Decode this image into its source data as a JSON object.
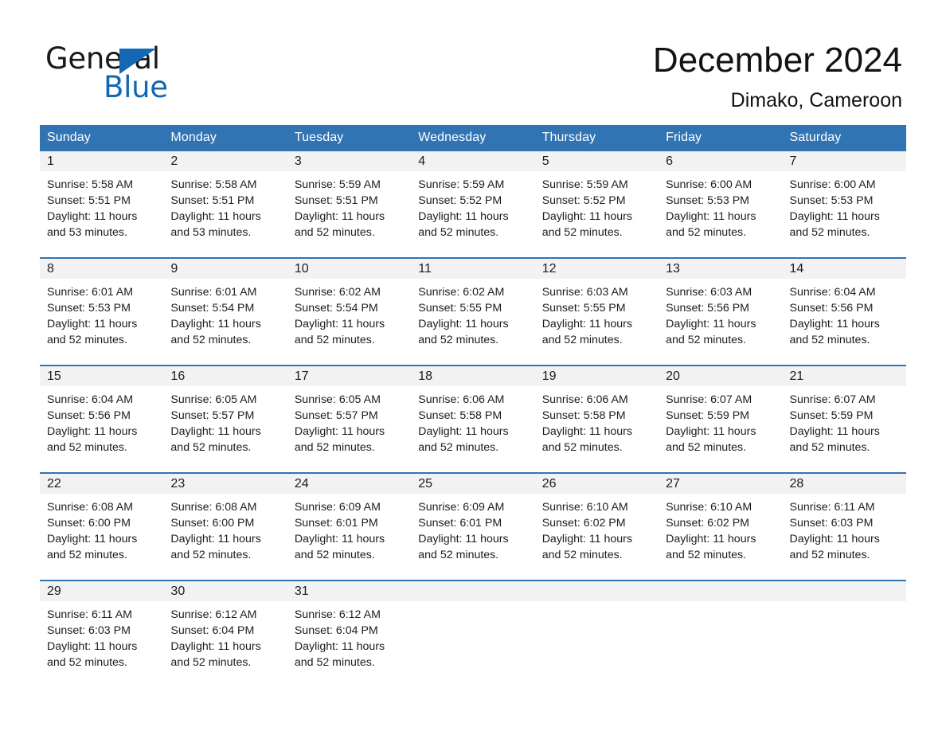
{
  "brand": {
    "name_part1": "General",
    "name_part2": "Blue",
    "accent_color": "#1268b3",
    "triangle_icon": "brand-triangle-icon"
  },
  "header": {
    "month_title": "December 2024",
    "location": "Dimako, Cameroon"
  },
  "theme": {
    "header_blue": "#3174b4",
    "row_divider_blue": "#3174b4",
    "daynum_band": "#f2f2f2",
    "text": "#1c1c1c"
  },
  "weekday_headers": [
    "Sunday",
    "Monday",
    "Tuesday",
    "Wednesday",
    "Thursday",
    "Friday",
    "Saturday"
  ],
  "weeks": [
    [
      {
        "day": "1",
        "sunrise": "Sunrise: 5:58 AM",
        "sunset": "Sunset: 5:51 PM",
        "daylight_line1": "Daylight: 11 hours",
        "daylight_line2": "and 53 minutes."
      },
      {
        "day": "2",
        "sunrise": "Sunrise: 5:58 AM",
        "sunset": "Sunset: 5:51 PM",
        "daylight_line1": "Daylight: 11 hours",
        "daylight_line2": "and 53 minutes."
      },
      {
        "day": "3",
        "sunrise": "Sunrise: 5:59 AM",
        "sunset": "Sunset: 5:51 PM",
        "daylight_line1": "Daylight: 11 hours",
        "daylight_line2": "and 52 minutes."
      },
      {
        "day": "4",
        "sunrise": "Sunrise: 5:59 AM",
        "sunset": "Sunset: 5:52 PM",
        "daylight_line1": "Daylight: 11 hours",
        "daylight_line2": "and 52 minutes."
      },
      {
        "day": "5",
        "sunrise": "Sunrise: 5:59 AM",
        "sunset": "Sunset: 5:52 PM",
        "daylight_line1": "Daylight: 11 hours",
        "daylight_line2": "and 52 minutes."
      },
      {
        "day": "6",
        "sunrise": "Sunrise: 6:00 AM",
        "sunset": "Sunset: 5:53 PM",
        "daylight_line1": "Daylight: 11 hours",
        "daylight_line2": "and 52 minutes."
      },
      {
        "day": "7",
        "sunrise": "Sunrise: 6:00 AM",
        "sunset": "Sunset: 5:53 PM",
        "daylight_line1": "Daylight: 11 hours",
        "daylight_line2": "and 52 minutes."
      }
    ],
    [
      {
        "day": "8",
        "sunrise": "Sunrise: 6:01 AM",
        "sunset": "Sunset: 5:53 PM",
        "daylight_line1": "Daylight: 11 hours",
        "daylight_line2": "and 52 minutes."
      },
      {
        "day": "9",
        "sunrise": "Sunrise: 6:01 AM",
        "sunset": "Sunset: 5:54 PM",
        "daylight_line1": "Daylight: 11 hours",
        "daylight_line2": "and 52 minutes."
      },
      {
        "day": "10",
        "sunrise": "Sunrise: 6:02 AM",
        "sunset": "Sunset: 5:54 PM",
        "daylight_line1": "Daylight: 11 hours",
        "daylight_line2": "and 52 minutes."
      },
      {
        "day": "11",
        "sunrise": "Sunrise: 6:02 AM",
        "sunset": "Sunset: 5:55 PM",
        "daylight_line1": "Daylight: 11 hours",
        "daylight_line2": "and 52 minutes."
      },
      {
        "day": "12",
        "sunrise": "Sunrise: 6:03 AM",
        "sunset": "Sunset: 5:55 PM",
        "daylight_line1": "Daylight: 11 hours",
        "daylight_line2": "and 52 minutes."
      },
      {
        "day": "13",
        "sunrise": "Sunrise: 6:03 AM",
        "sunset": "Sunset: 5:56 PM",
        "daylight_line1": "Daylight: 11 hours",
        "daylight_line2": "and 52 minutes."
      },
      {
        "day": "14",
        "sunrise": "Sunrise: 6:04 AM",
        "sunset": "Sunset: 5:56 PM",
        "daylight_line1": "Daylight: 11 hours",
        "daylight_line2": "and 52 minutes."
      }
    ],
    [
      {
        "day": "15",
        "sunrise": "Sunrise: 6:04 AM",
        "sunset": "Sunset: 5:56 PM",
        "daylight_line1": "Daylight: 11 hours",
        "daylight_line2": "and 52 minutes."
      },
      {
        "day": "16",
        "sunrise": "Sunrise: 6:05 AM",
        "sunset": "Sunset: 5:57 PM",
        "daylight_line1": "Daylight: 11 hours",
        "daylight_line2": "and 52 minutes."
      },
      {
        "day": "17",
        "sunrise": "Sunrise: 6:05 AM",
        "sunset": "Sunset: 5:57 PM",
        "daylight_line1": "Daylight: 11 hours",
        "daylight_line2": "and 52 minutes."
      },
      {
        "day": "18",
        "sunrise": "Sunrise: 6:06 AM",
        "sunset": "Sunset: 5:58 PM",
        "daylight_line1": "Daylight: 11 hours",
        "daylight_line2": "and 52 minutes."
      },
      {
        "day": "19",
        "sunrise": "Sunrise: 6:06 AM",
        "sunset": "Sunset: 5:58 PM",
        "daylight_line1": "Daylight: 11 hours",
        "daylight_line2": "and 52 minutes."
      },
      {
        "day": "20",
        "sunrise": "Sunrise: 6:07 AM",
        "sunset": "Sunset: 5:59 PM",
        "daylight_line1": "Daylight: 11 hours",
        "daylight_line2": "and 52 minutes."
      },
      {
        "day": "21",
        "sunrise": "Sunrise: 6:07 AM",
        "sunset": "Sunset: 5:59 PM",
        "daylight_line1": "Daylight: 11 hours",
        "daylight_line2": "and 52 minutes."
      }
    ],
    [
      {
        "day": "22",
        "sunrise": "Sunrise: 6:08 AM",
        "sunset": "Sunset: 6:00 PM",
        "daylight_line1": "Daylight: 11 hours",
        "daylight_line2": "and 52 minutes."
      },
      {
        "day": "23",
        "sunrise": "Sunrise: 6:08 AM",
        "sunset": "Sunset: 6:00 PM",
        "daylight_line1": "Daylight: 11 hours",
        "daylight_line2": "and 52 minutes."
      },
      {
        "day": "24",
        "sunrise": "Sunrise: 6:09 AM",
        "sunset": "Sunset: 6:01 PM",
        "daylight_line1": "Daylight: 11 hours",
        "daylight_line2": "and 52 minutes."
      },
      {
        "day": "25",
        "sunrise": "Sunrise: 6:09 AM",
        "sunset": "Sunset: 6:01 PM",
        "daylight_line1": "Daylight: 11 hours",
        "daylight_line2": "and 52 minutes."
      },
      {
        "day": "26",
        "sunrise": "Sunrise: 6:10 AM",
        "sunset": "Sunset: 6:02 PM",
        "daylight_line1": "Daylight: 11 hours",
        "daylight_line2": "and 52 minutes."
      },
      {
        "day": "27",
        "sunrise": "Sunrise: 6:10 AM",
        "sunset": "Sunset: 6:02 PM",
        "daylight_line1": "Daylight: 11 hours",
        "daylight_line2": "and 52 minutes."
      },
      {
        "day": "28",
        "sunrise": "Sunrise: 6:11 AM",
        "sunset": "Sunset: 6:03 PM",
        "daylight_line1": "Daylight: 11 hours",
        "daylight_line2": "and 52 minutes."
      }
    ],
    [
      {
        "day": "29",
        "sunrise": "Sunrise: 6:11 AM",
        "sunset": "Sunset: 6:03 PM",
        "daylight_line1": "Daylight: 11 hours",
        "daylight_line2": "and 52 minutes."
      },
      {
        "day": "30",
        "sunrise": "Sunrise: 6:12 AM",
        "sunset": "Sunset: 6:04 PM",
        "daylight_line1": "Daylight: 11 hours",
        "daylight_line2": "and 52 minutes."
      },
      {
        "day": "31",
        "sunrise": "Sunrise: 6:12 AM",
        "sunset": "Sunset: 6:04 PM",
        "daylight_line1": "Daylight: 11 hours",
        "daylight_line2": "and 52 minutes."
      },
      {
        "day": "",
        "sunrise": "",
        "sunset": "",
        "daylight_line1": "",
        "daylight_line2": ""
      },
      {
        "day": "",
        "sunrise": "",
        "sunset": "",
        "daylight_line1": "",
        "daylight_line2": ""
      },
      {
        "day": "",
        "sunrise": "",
        "sunset": "",
        "daylight_line1": "",
        "daylight_line2": ""
      },
      {
        "day": "",
        "sunrise": "",
        "sunset": "",
        "daylight_line1": "",
        "daylight_line2": ""
      }
    ]
  ]
}
